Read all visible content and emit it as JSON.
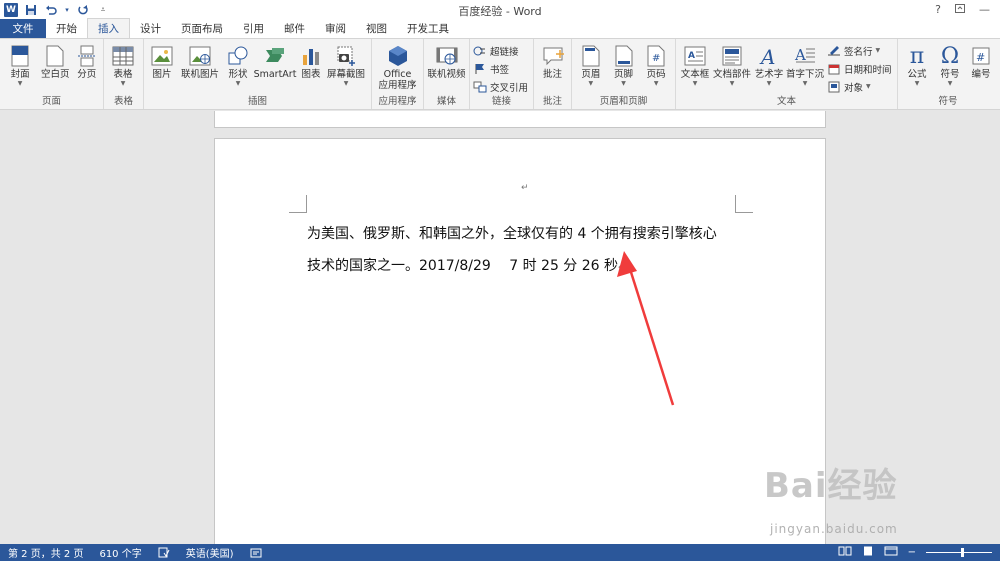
{
  "window": {
    "title": "百度经验 - Word",
    "help_label": "?",
    "app_icon_letter": "W"
  },
  "tabs": {
    "file": "文件",
    "items": [
      "开始",
      "插入",
      "设计",
      "页面布局",
      "引用",
      "邮件",
      "审阅",
      "视图",
      "开发工具"
    ],
    "active_index": 1
  },
  "ribbon": {
    "pages": {
      "label": "页面",
      "cover": "封面",
      "blank": "空白页",
      "break": "分页"
    },
    "tables": {
      "label": "表格",
      "table": "表格"
    },
    "illustrations": {
      "label": "插图",
      "picture": "图片",
      "online_picture": "联机图片",
      "shapes": "形状",
      "smartart": "SmartArt",
      "chart": "图表",
      "screenshot": "屏幕截图"
    },
    "apps": {
      "label": "应用程序",
      "office_line1": "Office",
      "office_line2": "应用程序"
    },
    "media": {
      "label": "媒体",
      "online_video": "联机视频"
    },
    "links": {
      "label": "链接",
      "hyperlink": "超链接",
      "bookmark": "书签",
      "cross_ref": "交叉引用"
    },
    "comments": {
      "label": "批注",
      "comment": "批注"
    },
    "header_footer": {
      "label": "页眉和页脚",
      "header": "页眉",
      "footer": "页脚",
      "page_number": "页码"
    },
    "text": {
      "label": "文本",
      "textbox": "文本框",
      "quick_parts": "文档部件",
      "wordart": "艺术字",
      "dropcap": "首字下沉",
      "signature": "签名行",
      "datetime": "日期和时间",
      "object": "对象"
    },
    "symbols": {
      "label": "符号",
      "equation": "公式",
      "symbol": "符号",
      "number": "编号"
    }
  },
  "document": {
    "line1": "为美国、俄罗斯、和韩国之外，全球仅有的 4 个拥有搜索引擎核心",
    "line2": "技术的国家之一。2017/8/29　 7 时 25 分 26 秒",
    "para_mark": "↵"
  },
  "watermark": {
    "main": "Bai经验",
    "sub": "jingyan.baidu.com"
  },
  "status": {
    "page": "第 2 页，共 2 页",
    "words": "610 个字",
    "language": "英语(美国)",
    "zoom_fraction": 0.55
  },
  "colors": {
    "accent": "#2b579a",
    "arrow": "#f03c3c"
  }
}
